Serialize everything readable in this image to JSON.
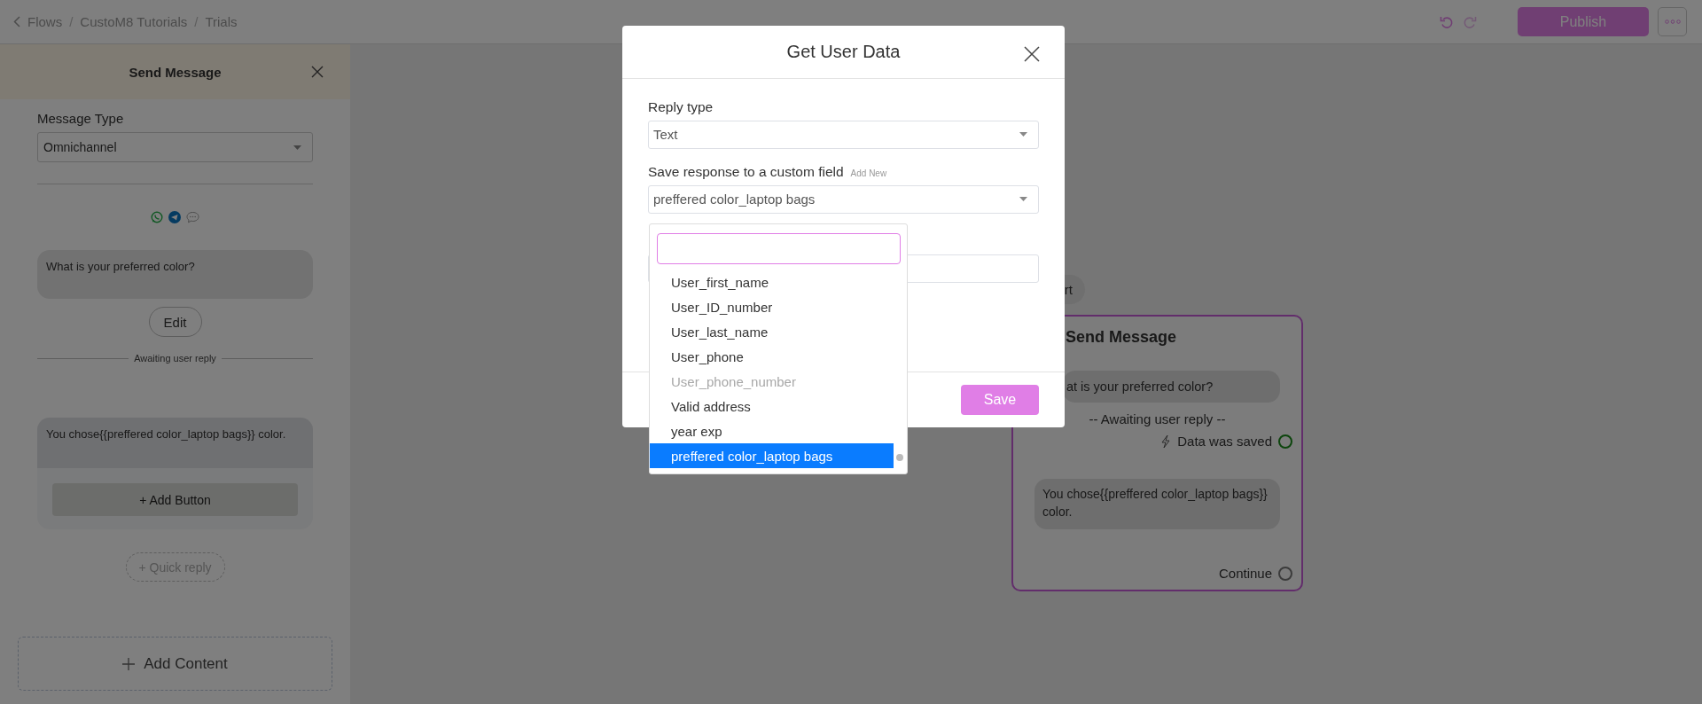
{
  "breadcrumb": [
    {
      "kind": "link",
      "text": "Flows"
    },
    {
      "kind": "separator",
      "text": "/"
    },
    {
      "kind": "link",
      "text": "CustoM8 Tutorials"
    },
    {
      "kind": "separator",
      "text": "/"
    },
    {
      "kind": "link",
      "text": "Trials"
    }
  ],
  "toolbar": {
    "publish": "Publish"
  },
  "side_panel": {
    "title": "Send Message",
    "message_type_label": "Message Type",
    "message_type": "Omnichannel",
    "message": "What is your preferred color?",
    "edit": "Edit",
    "awaiting": "Awaiting user reply",
    "reply_message": "You chose{{preffered color_laptop bags}} color.",
    "add_button": "+ Add Button",
    "quick_reply": "+ Quick reply",
    "add_content": "Add Content"
  },
  "canvas": {
    "start_node": "rt",
    "node": {
      "title": "Send Message",
      "message": "at is your preferred color?",
      "awaiting": "-- Awaiting user reply --",
      "saved": "Data was saved",
      "reply": "You chose{{preffered color_laptop bags}} color.",
      "continue": "Continue"
    }
  },
  "modal": {
    "title": "Get User Data",
    "reply_type_label": "Reply type",
    "reply_type": "Text",
    "custom_field_label": "Save response to a custom field",
    "add_new": "Add New",
    "custom_field": "preffered color_laptop bags",
    "options": [
      {
        "label": "User_first_name",
        "disabled": false,
        "selected": false
      },
      {
        "label": "User_ID_number",
        "disabled": false,
        "selected": false
      },
      {
        "label": "User_last_name",
        "disabled": false,
        "selected": false
      },
      {
        "label": "User_phone",
        "disabled": false,
        "selected": false
      },
      {
        "label": "User_phone_number",
        "disabled": true,
        "selected": false
      },
      {
        "label": "Valid address",
        "disabled": false,
        "selected": false
      },
      {
        "label": "year exp",
        "disabled": false,
        "selected": false
      },
      {
        "label": "preffered color_laptop bags",
        "disabled": false,
        "selected": true
      }
    ],
    "save": "Save"
  }
}
